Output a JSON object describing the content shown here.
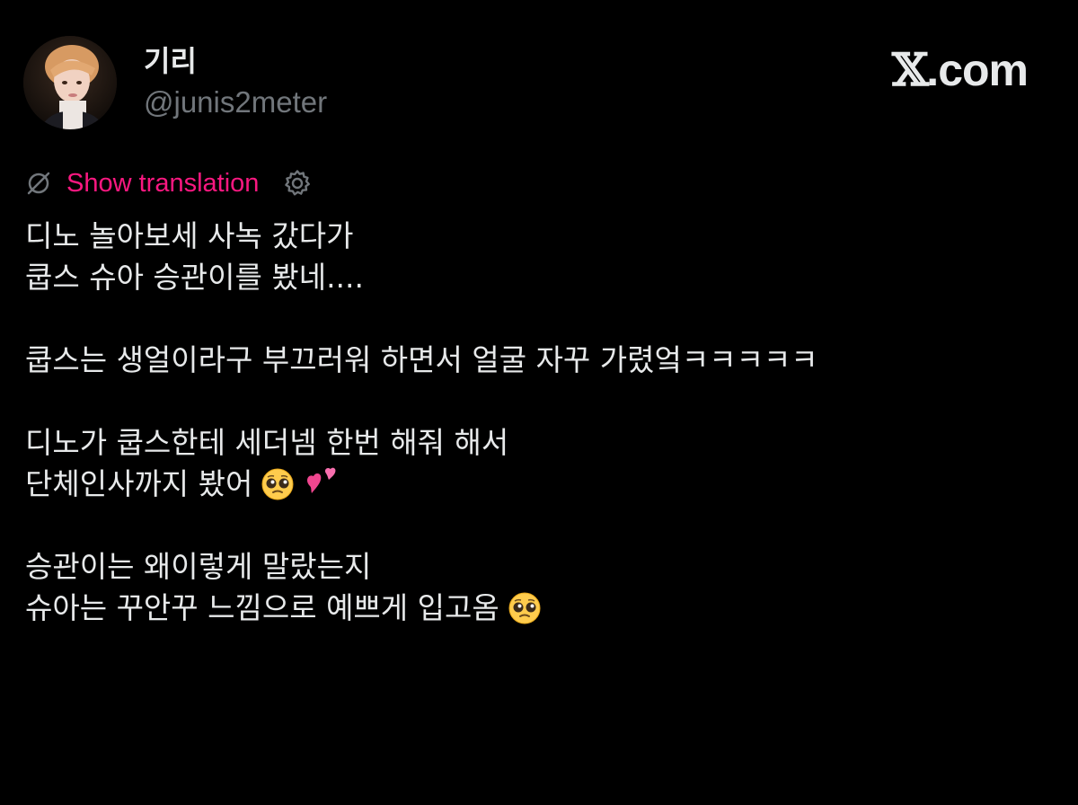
{
  "author": {
    "display_name": "기리",
    "handle": "@junis2meter"
  },
  "brand": {
    "glyph": "𝕏",
    "suffix": ".com"
  },
  "translation": {
    "link_label": "Show translation"
  },
  "tweet": {
    "lines": [
      "디노 놀아보세 사녹 갔다가",
      "쿱스 슈아 승관이를 봤네....",
      "",
      "쿱스는 생얼이라구 부끄러워 하면서 얼굴 자꾸 가렸엌ㅋㅋㅋㅋㅋ",
      "",
      "디노가 쿱스한테 세더넴 한번 해줘 해서",
      "단체인사까지 봤어",
      "",
      "승관이는 왜이렇게 말랐는지",
      "슈아는 꾸안꾸 느낌으로 예쁘게 입고옴"
    ],
    "emoji": {
      "line_7": [
        "pleading-face-emoji",
        "two-hearts-emoji"
      ],
      "line_10": [
        "pleading-face-emoji"
      ]
    }
  },
  "colors": {
    "background": "#000000",
    "text": "#e7e9ea",
    "secondary": "#71767b",
    "accent": "#f91880"
  }
}
